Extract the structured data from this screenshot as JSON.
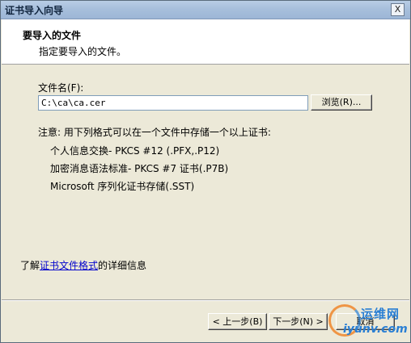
{
  "window": {
    "title": "证书导入向导",
    "close_glyph": "X"
  },
  "header": {
    "title": "要导入的文件",
    "subtitle": "指定要导入的文件。"
  },
  "file": {
    "label": "文件名(F):",
    "value": "C:\\ca\\ca.cer",
    "browse_label": "浏览(R)..."
  },
  "note": {
    "intro": "注意: 用下列格式可以在一个文件中存储一个以上证书:",
    "formats": [
      "个人信息交换- PKCS #12 (.PFX,.P12)",
      "加密消息语法标准- PKCS #7 证书(.P7B)",
      "Microsoft 序列化证书存储(.SST)"
    ]
  },
  "more_info": {
    "prefix": "了解",
    "link": "证书文件格式",
    "suffix": "的详细信息"
  },
  "buttons": {
    "back": "< 上一步(B)",
    "next": "下一步(N) >",
    "cancel": "取消"
  },
  "watermark": {
    "cn": "运维网",
    "en": "iyunv.com"
  }
}
